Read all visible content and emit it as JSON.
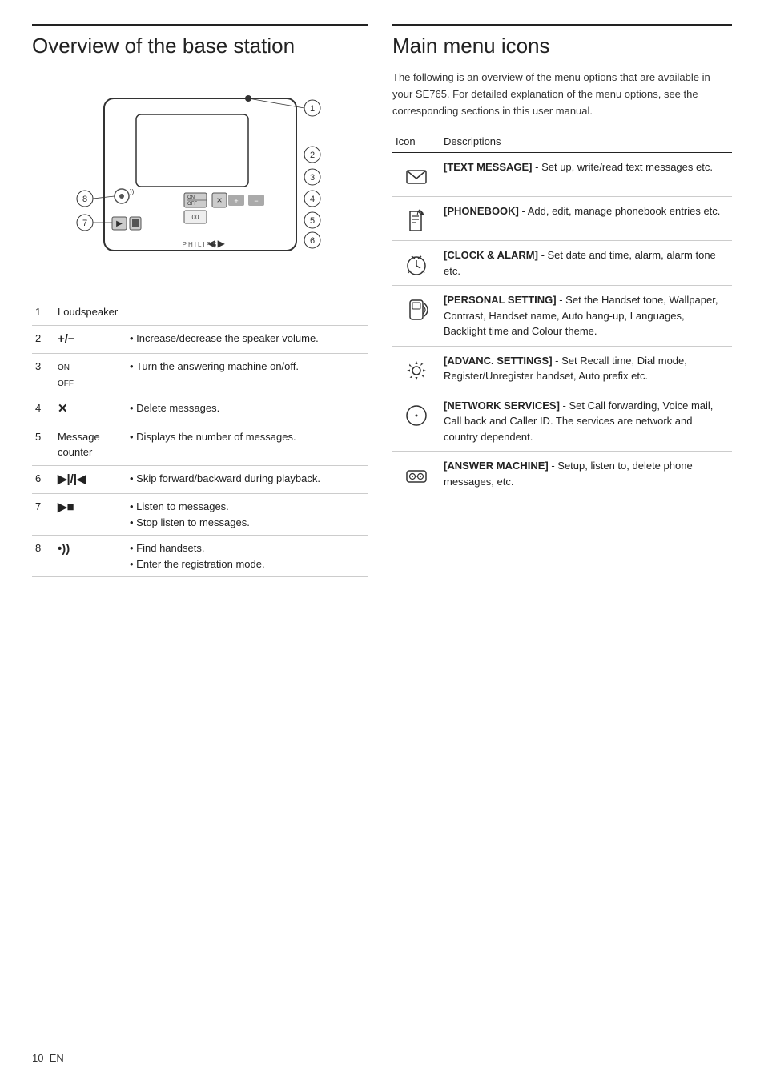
{
  "left_section": {
    "title": "Overview of the base station",
    "features": [
      {
        "num": "1",
        "label": "Loudspeaker",
        "description": ""
      },
      {
        "num": "2",
        "symbol": "+/−",
        "label": "",
        "bullets": [
          "Increase/decrease the speaker volume."
        ]
      },
      {
        "num": "3",
        "symbol": "ON/OFF",
        "label": "",
        "bullets": [
          "Turn the answering machine on/off."
        ]
      },
      {
        "num": "4",
        "symbol": "✕",
        "label": "",
        "bullets": [
          "Delete messages."
        ]
      },
      {
        "num": "5",
        "label": "Message counter",
        "bullets": [
          "Displays the number of messages."
        ]
      },
      {
        "num": "6",
        "symbol": "▶|/|◀",
        "label": "",
        "bullets": [
          "Skip forward/backward during playback."
        ]
      },
      {
        "num": "7",
        "symbol": "▶■",
        "label": "",
        "bullets": [
          "Listen to messages.",
          "Stop listen to messages."
        ]
      },
      {
        "num": "8",
        "symbol": "•))",
        "label": "",
        "bullets": [
          "Find handsets.",
          "Enter the registration mode."
        ]
      }
    ]
  },
  "right_section": {
    "title": "Main menu icons",
    "intro": "The following is an overview of the menu options that are available in your SE765. For detailed explanation of the menu options, see the corresponding sections in this user manual.",
    "table_headers": [
      "Icon",
      "Descriptions"
    ],
    "menu_items": [
      {
        "icon": "envelope",
        "key": "[TEXT MESSAGE]",
        "description": " - Set up, write/read text messages etc."
      },
      {
        "icon": "phonebook",
        "key": "[PHONEBOOK]",
        "description": " - Add, edit, manage phonebook entries etc."
      },
      {
        "icon": "clock",
        "key": "[CLOCK & ALARM]",
        "description": " - Set date and time, alarm, alarm tone etc."
      },
      {
        "icon": "personal",
        "key": "[PERSONAL SETTING]",
        "description": " - Set the Handset tone, Wallpaper, Contrast, Handset name, Auto hang-up, Languages, Backlight time and Colour theme."
      },
      {
        "icon": "settings",
        "key": "[ADVANC. SETTINGS]",
        "description": " - Set Recall time, Dial mode, Register/Unregister handset, Auto prefix etc."
      },
      {
        "icon": "network",
        "key": "[NETWORK SERVICES]",
        "description": " - Set Call forwarding, Voice mail, Call back and Caller ID. The services are network and country dependent."
      },
      {
        "icon": "answermachine",
        "key": "[ANSWER MACHINE]",
        "description": " - Setup, listen to, delete phone messages, etc."
      }
    ]
  },
  "page_number": "10",
  "page_lang": "EN"
}
